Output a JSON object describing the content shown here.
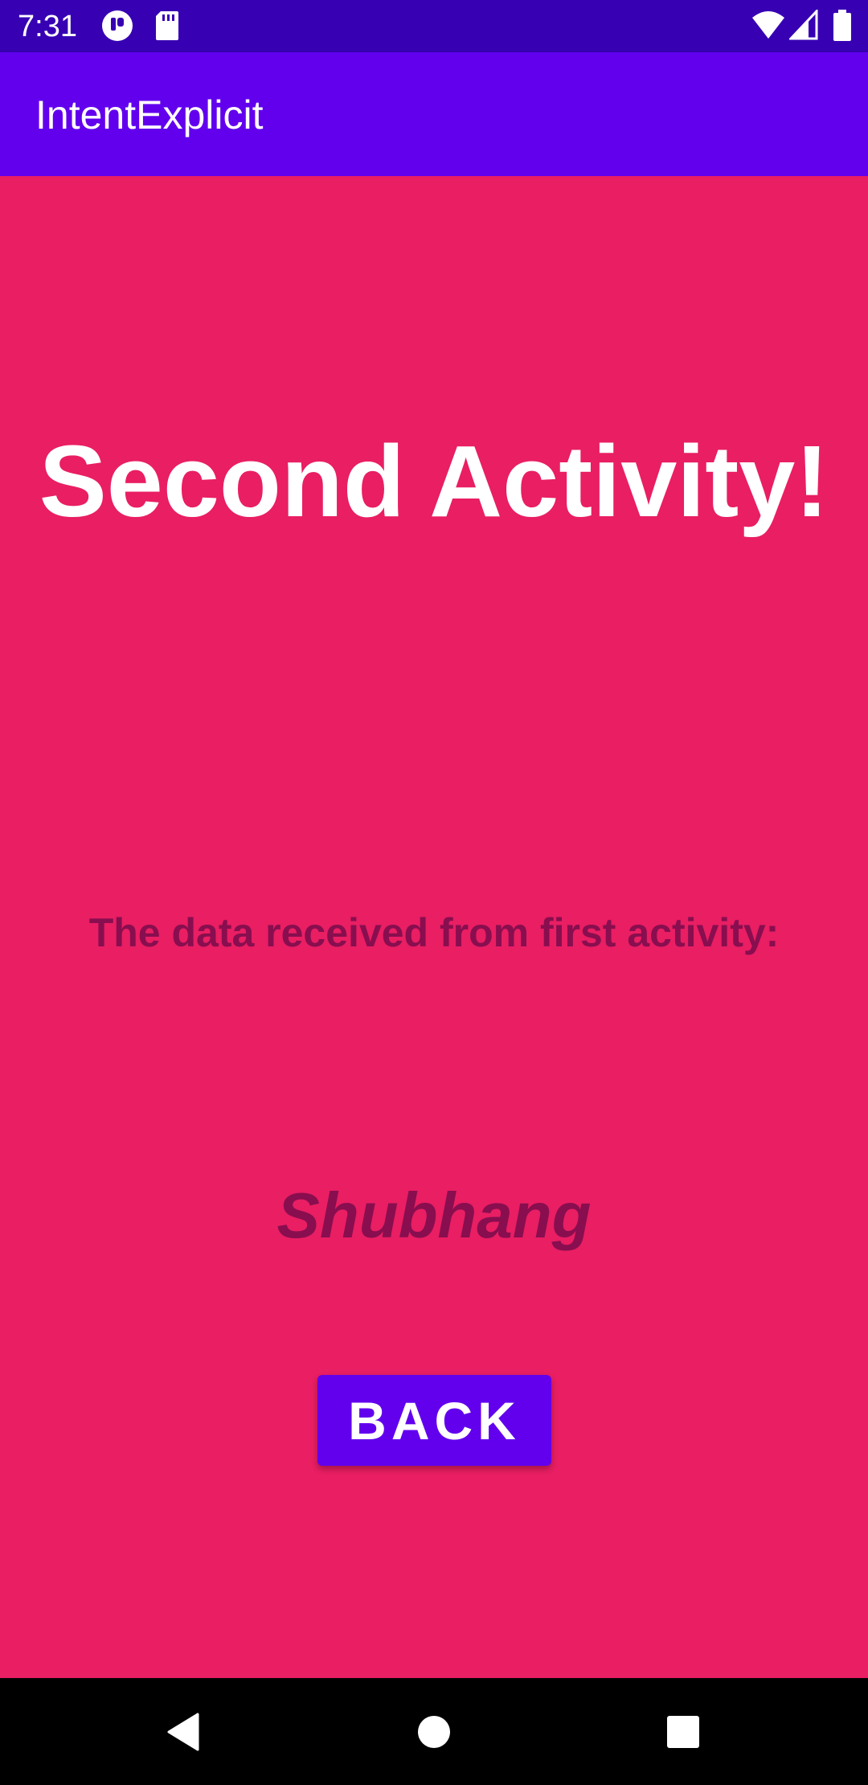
{
  "status_bar": {
    "time": "7:31",
    "icons": [
      "pocket-icon",
      "sd-card-icon",
      "wifi-icon",
      "signal-icon",
      "battery-icon"
    ],
    "background": "#3700B3"
  },
  "app_bar": {
    "title": "IntentExplicit",
    "background": "#6200EE"
  },
  "main": {
    "background": "#E91E63",
    "heading": "Second Activity!",
    "data_label": "The data received from first activity:",
    "received_value": "Shubhang",
    "back_button_label": "BACK",
    "accent_text_color": "#880E4F"
  },
  "nav_bar": {
    "buttons": [
      "back-triangle-icon",
      "home-circle-icon",
      "recents-square-icon"
    ]
  }
}
